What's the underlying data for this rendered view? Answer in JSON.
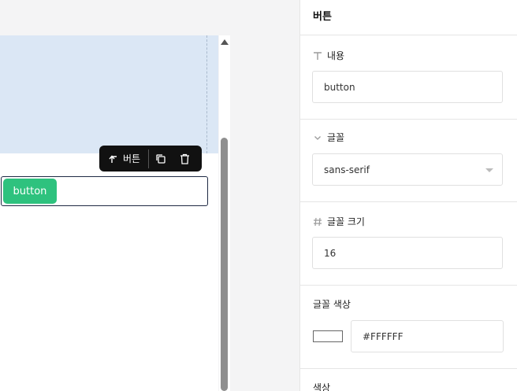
{
  "toolbar": {
    "parent_label": "버튼"
  },
  "canvas": {
    "button_label": "button"
  },
  "panel": {
    "title": "버튼",
    "content": {
      "label": "내용",
      "value": "button"
    },
    "font": {
      "label": "글꼴",
      "value": "sans-serif"
    },
    "font_size": {
      "label": "글꼴 크기",
      "value": "16"
    },
    "font_color": {
      "label": "글꼴 색상",
      "value": "#FFFFFF"
    },
    "color": {
      "label": "색상"
    }
  },
  "colors": {
    "button": "#2ec27e",
    "selection": "#dbe7f5"
  }
}
